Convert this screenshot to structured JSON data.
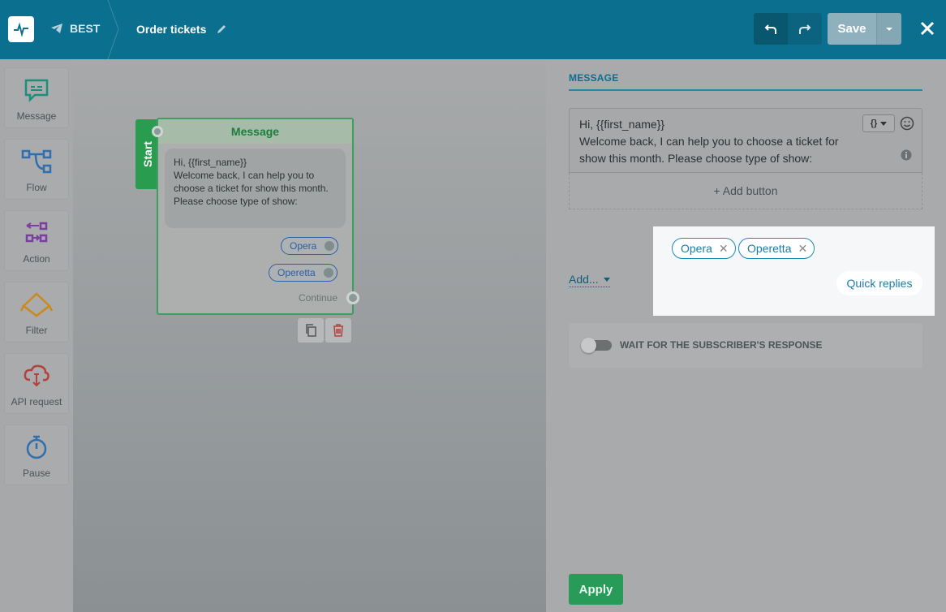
{
  "header": {
    "project": "BEST",
    "flow_name": "Order tickets",
    "save_label": "Save"
  },
  "sidebar": {
    "items": [
      {
        "label": "Message",
        "icon": "message-icon",
        "color": "#1a8f7a"
      },
      {
        "label": "Flow",
        "icon": "flow-icon",
        "color": "#2e6fb0"
      },
      {
        "label": "Action",
        "icon": "action-icon",
        "color": "#7b3fa0"
      },
      {
        "label": "Filter",
        "icon": "filter-icon",
        "color": "#c98a1e"
      },
      {
        "label": "API request",
        "icon": "api-cloud-icon",
        "color": "#b0443c"
      },
      {
        "label": "Pause",
        "icon": "stopwatch-icon",
        "color": "#2e6fb0"
      }
    ]
  },
  "canvas": {
    "start_label": "Start",
    "node": {
      "title": "Message",
      "text_line1": "Hi,  {{first_name}}",
      "text_line2": "Welcome back, I can help you to choose a ticket for show this month. Please choose type of show:",
      "quick_replies": [
        "Opera",
        "Operetta"
      ],
      "continue_label": "Continue"
    }
  },
  "panel": {
    "tab_label": "MESSAGE",
    "message_line1": "Hi,  {{first_name}}",
    "message_line2": "Welcome back, I can help you to choose a ticket for show this month. Please choose type of show:",
    "variable_button": "{}",
    "add_button_label": "+ Add button",
    "add_dropdown_label": "Add...",
    "quick_reply_chips": [
      "Opera",
      "Operetta"
    ],
    "quick_replies_label": "Quick replies",
    "wait_label": "WAIT FOR THE SUBSCRIBER'S RESPONSE",
    "wait_enabled": false,
    "apply_label": "Apply"
  },
  "colors": {
    "header": "#0b6f8f",
    "accent_green": "#279b57",
    "link_blue": "#1a7da8"
  }
}
